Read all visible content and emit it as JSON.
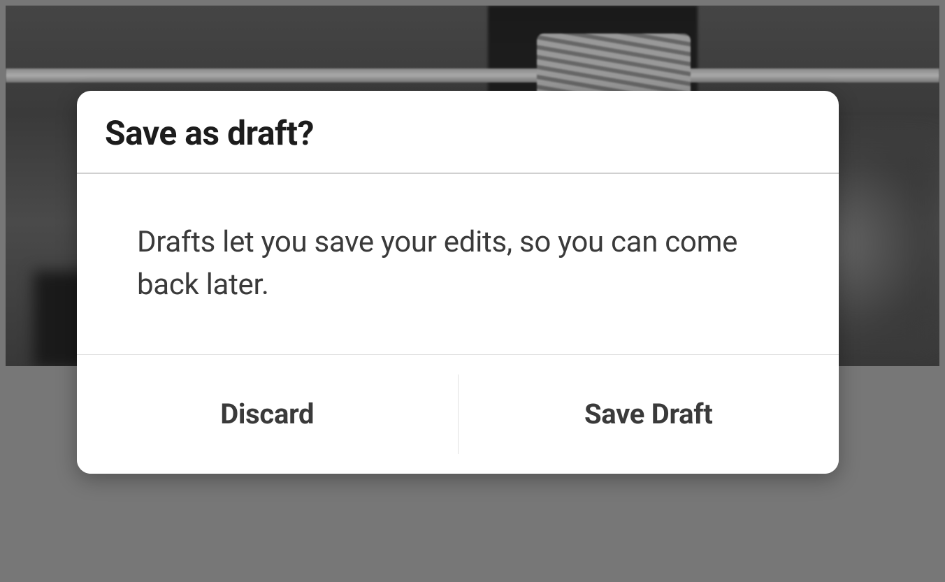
{
  "dialog": {
    "title": "Save as draft?",
    "message": "Drafts let you save your edits, so you can come back later.",
    "buttons": {
      "discard": "Discard",
      "save": "Save Draft"
    }
  }
}
